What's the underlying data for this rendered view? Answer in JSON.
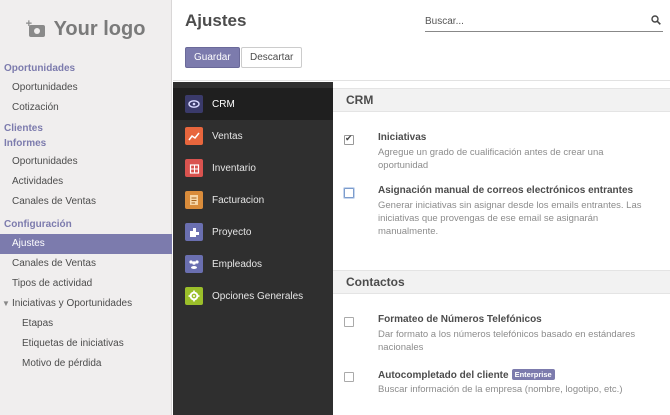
{
  "logo": {
    "text": "Your logo",
    "icon": "camera-plus-icon"
  },
  "sidebar": {
    "sections": [
      {
        "title": "Oportunidades",
        "items": [
          {
            "label": "Oportunidades"
          },
          {
            "label": "Cotización"
          }
        ]
      },
      {
        "title": "Clientes",
        "items": []
      },
      {
        "title": "Informes",
        "items": [
          {
            "label": "Oportunidades"
          },
          {
            "label": "Actividades"
          },
          {
            "label": "Canales de Ventas"
          }
        ]
      },
      {
        "title": "Configuración",
        "items": [
          {
            "label": "Ajustes",
            "active": true
          },
          {
            "label": "Canales de Ventas"
          },
          {
            "label": "Tipos de actividad"
          },
          {
            "label": "Iniciativas y Oportunidades",
            "expanded": true
          },
          {
            "label": "Etapas",
            "sub": true
          },
          {
            "label": "Etiquetas de iniciativas",
            "sub": true
          },
          {
            "label": "Motivo de pérdida",
            "sub": true
          }
        ]
      }
    ]
  },
  "header": {
    "title": "Ajustes",
    "search_placeholder": "Buscar...",
    "save_label": "Guardar",
    "discard_label": "Descartar"
  },
  "apps": [
    {
      "label": "CRM",
      "icon": "crm-handshake-icon",
      "color": "#3a3a6a",
      "active": true
    },
    {
      "label": "Ventas",
      "icon": "sales-chart-icon",
      "color": "#e8663d"
    },
    {
      "label": "Inventario",
      "icon": "inventory-box-icon",
      "color": "#d9534f"
    },
    {
      "label": "Facturacion",
      "icon": "invoice-icon",
      "color": "#d98c3b"
    },
    {
      "label": "Proyecto",
      "icon": "project-puzzle-icon",
      "color": "#6a6fb0"
    },
    {
      "label": "Empleados",
      "icon": "employees-icon",
      "color": "#6a6fb0"
    },
    {
      "label": "Opciones Generales",
      "icon": "general-settings-gear-icon",
      "color": "#9bbf2a"
    }
  ],
  "settings": {
    "crm": {
      "title": "CRM",
      "leads_name": "Iniciativas",
      "leads_desc": "Agregue un grado de cualificación antes de crear una oportunidad",
      "leads_checked": true,
      "manual_name": "Asignación manual de correos electrónicos entrantes",
      "manual_desc": "Generar iniciativas sin asignar desde los emails entrantes. Las iniciativas que provengas de ese email se asignarán manualmente.",
      "manual_checked": false
    },
    "contacts": {
      "title": "Contactos",
      "phone_name": "Formateo de Números Telefónicos",
      "phone_desc": "Dar formato a los números telefónicos basado en estándares nacionales",
      "phone_checked": false,
      "autocomplete_name": "Autocompletado del cliente",
      "autocomplete_badge": "Enterprise",
      "autocomplete_desc": "Buscar información de la empresa (nombre, logotipo, etc.)",
      "autocomplete_checked": false
    }
  }
}
